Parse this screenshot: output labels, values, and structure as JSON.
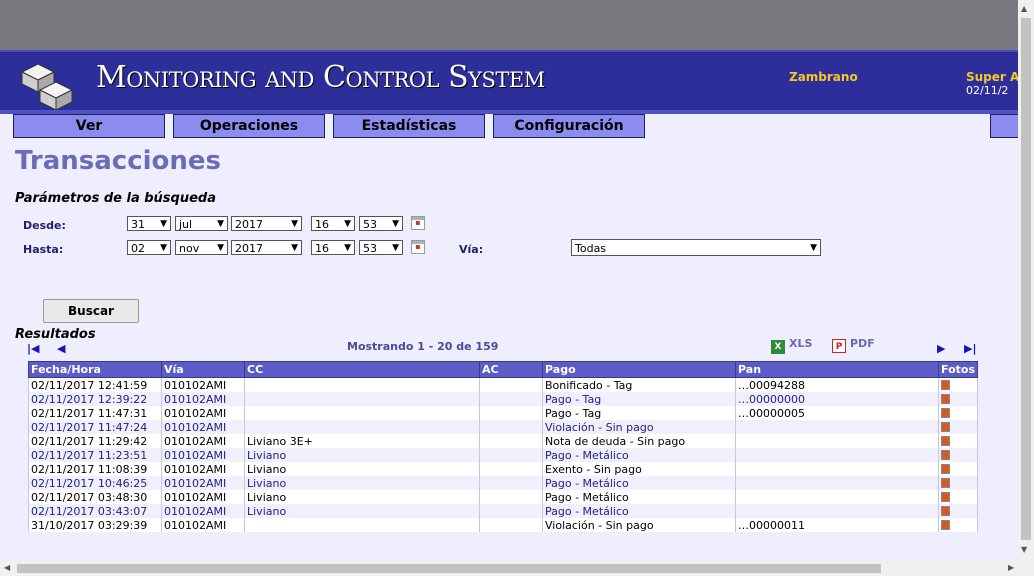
{
  "header": {
    "title": "Monitoring and Control System",
    "user": "Zambrano",
    "role": "Super A",
    "date": "02/11/2"
  },
  "menu": [
    "Ver",
    "Operaciones",
    "Estadísticas",
    "Configuración"
  ],
  "page_title": "Transacciones",
  "search": {
    "section": "Parámetros de la búsqueda",
    "desde_label": "Desde:",
    "hasta_label": "Hasta:",
    "via_label": "Vía:",
    "desde": {
      "day": "31",
      "month": "jul",
      "year": "2017",
      "hour": "16",
      "minute": "53"
    },
    "hasta": {
      "day": "02",
      "month": "nov",
      "year": "2017",
      "hour": "16",
      "minute": "53"
    },
    "via": "Todas",
    "button": "Buscar"
  },
  "results": {
    "section": "Resultados",
    "showing": "Mostrando 1 - 20 de 159",
    "xls": "XLS",
    "pdf": "PDF",
    "columns": [
      "Fecha/Hora",
      "Vía",
      "CC",
      "AC",
      "Pago",
      "Pan",
      "Fotos"
    ],
    "rows": [
      [
        "02/11/2017 12:41:59",
        "010102AMI",
        "",
        "",
        "Bonificado - Tag",
        "…00094288"
      ],
      [
        "02/11/2017 12:39:22",
        "010102AMI",
        "",
        "",
        "Pago - Tag",
        "…00000000"
      ],
      [
        "02/11/2017 11:47:31",
        "010102AMI",
        "",
        "",
        "Pago - Tag",
        "…00000005"
      ],
      [
        "02/11/2017 11:47:24",
        "010102AMI",
        "",
        "",
        "Violación - Sin pago",
        ""
      ],
      [
        "02/11/2017 11:29:42",
        "010102AMI",
        "Liviano 3E+",
        "",
        "Nota de deuda - Sin pago",
        ""
      ],
      [
        "02/11/2017 11:23:51",
        "010102AMI",
        "Liviano",
        "",
        "Pago - Metálico",
        ""
      ],
      [
        "02/11/2017 11:08:39",
        "010102AMI",
        "Liviano",
        "",
        "Exento - Sin pago",
        ""
      ],
      [
        "02/11/2017 10:46:25",
        "010102AMI",
        "Liviano",
        "",
        "Pago - Metálico",
        ""
      ],
      [
        "02/11/2017 03:48:30",
        "010102AMI",
        "Liviano",
        "",
        "Pago - Metálico",
        ""
      ],
      [
        "02/11/2017 03:43:07",
        "010102AMI",
        "Liviano",
        "",
        "Pago - Metálico",
        ""
      ],
      [
        "31/10/2017 03:29:39",
        "010102AMI",
        "",
        "",
        "Violación - Sin pago",
        "…00000011"
      ]
    ]
  },
  "colors": {
    "header_bg": "#2e2e9a",
    "menu_bg": "#8b8bf0",
    "table_header": "#5c5cc6",
    "accent_text": "#f5c825"
  }
}
